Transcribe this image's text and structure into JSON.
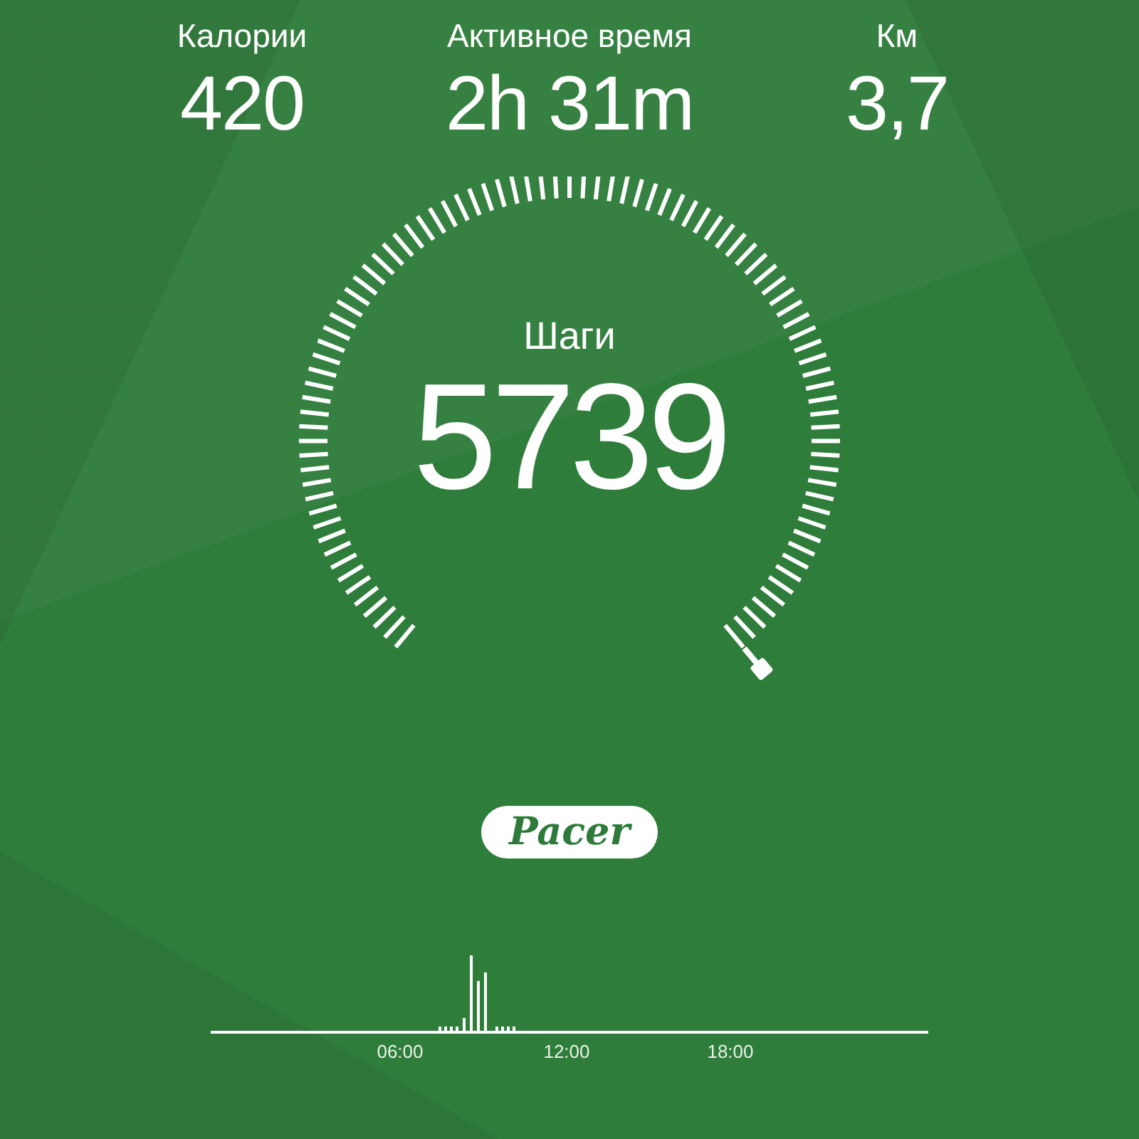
{
  "stats": [
    {
      "label": "Калории",
      "value": "420"
    },
    {
      "label": "Активное время",
      "value": "2h 31m"
    },
    {
      "label": "Км",
      "value": "3,7"
    }
  ],
  "steps": {
    "label": "Шаги",
    "value": "5739"
  },
  "logo": "Pacer",
  "timeline": {
    "labels": [
      "06:00",
      "12:00",
      "18:00"
    ]
  }
}
